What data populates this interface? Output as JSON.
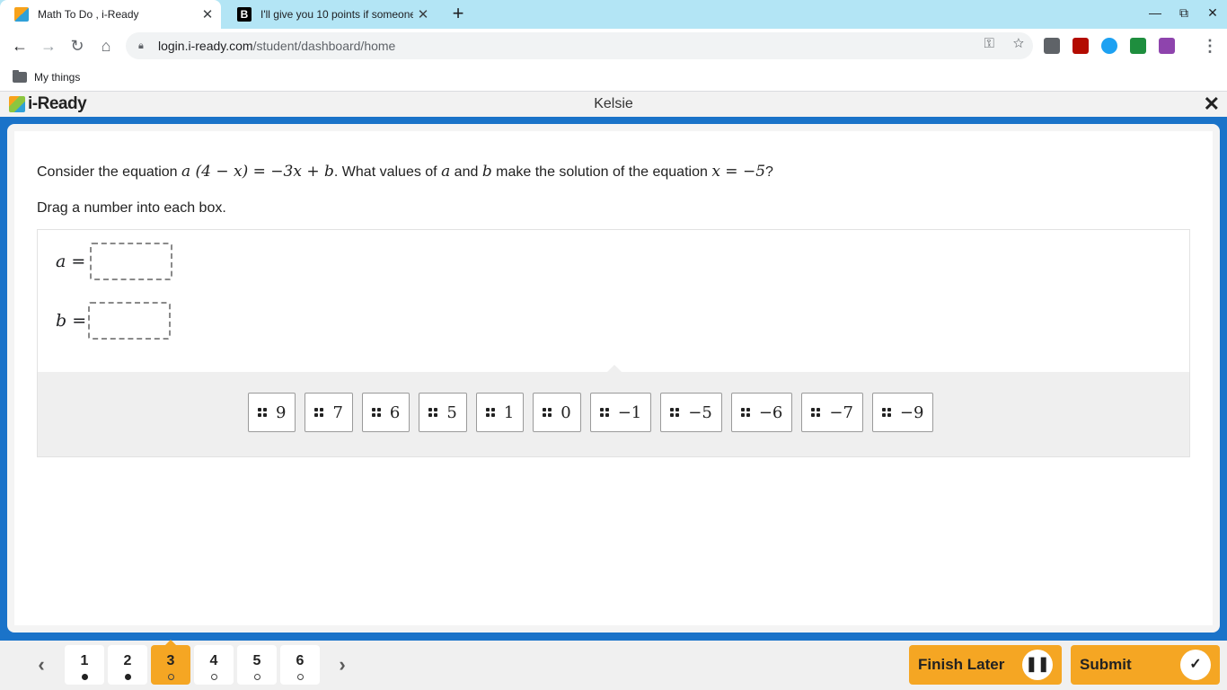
{
  "browser": {
    "tabs": [
      {
        "title": "Math To Do , i-Ready",
        "close": "✕"
      },
      {
        "title": "I'll give you 10 points if someone",
        "close": "✕"
      }
    ],
    "new_tab": "+",
    "window_controls": {
      "minimize": "—",
      "restore": "⧉",
      "close": "✕"
    },
    "nav": {
      "back": "←",
      "forward": "→",
      "reload": "↻",
      "home": "⌂"
    },
    "url": {
      "host": "login.i-ready.com",
      "path": "/student/dashboard/home"
    },
    "omnibox_icons": {
      "key": "⚿",
      "star": "☆"
    },
    "menu": "⋮",
    "bookmarks": [
      {
        "label": "My things"
      }
    ]
  },
  "app": {
    "logo_text": "i-Ready",
    "student_name": "Kelsie",
    "close": "✕"
  },
  "question": {
    "prefix": "Consider the equation ",
    "equation": "a (4 − x) = −3x + b",
    "mid1": ". What values of ",
    "var_a": "a",
    "and": " and ",
    "var_b": "b",
    "mid2": " make the solution of the equation ",
    "solution": "x = −5",
    "suffix": "?",
    "instruction": "Drag a number into each box."
  },
  "answers": {
    "a_label": "a =",
    "b_label": "b ="
  },
  "tiles": [
    "9",
    "7",
    "6",
    "5",
    "1",
    "0",
    "−1",
    "−5",
    "−6",
    "−7",
    "−9"
  ],
  "footer": {
    "prev": "‹",
    "next": "›",
    "questions": [
      {
        "label": "1",
        "state": "answered"
      },
      {
        "label": "2",
        "state": "answered"
      },
      {
        "label": "3",
        "state": "current"
      },
      {
        "label": "4",
        "state": "unanswered"
      },
      {
        "label": "5",
        "state": "unanswered"
      },
      {
        "label": "6",
        "state": "unanswered"
      }
    ],
    "finish_later": "Finish Later",
    "finish_icon": "❚❚",
    "submit": "Submit",
    "submit_icon": "✓"
  },
  "colors": {
    "accent": "#1a73c9",
    "button": "#f5a623",
    "tab_strip": "#b3e5f5"
  }
}
